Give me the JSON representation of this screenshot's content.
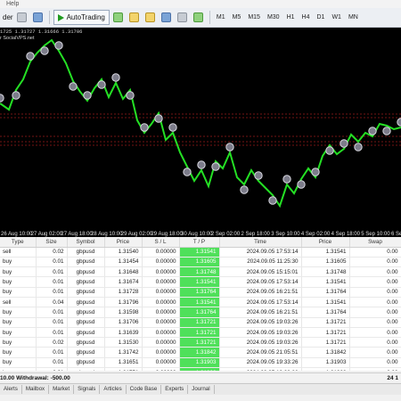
{
  "menubar": {
    "items": [
      "Help"
    ]
  },
  "toolbar": {
    "order_label": "der",
    "autotrading_label": "AutoTrading",
    "timeframes": [
      "M1",
      "M5",
      "M15",
      "M30",
      "H1",
      "H4",
      "D1",
      "W1",
      "MN"
    ]
  },
  "chart": {
    "info_line": "1725 1.31727 1.31666 1.31706",
    "sub_line": "r SocialVPS.net",
    "bg_color": "#000000",
    "line_color": "#24e024",
    "level_color": "#9c1a1a",
    "x_ticks": [
      "26 Aug 10:00",
      "27 Aug 02:00",
      "27 Aug 18:00",
      "28 Aug 10:00",
      "29 Aug 02:00",
      "29 Aug 18:00",
      "30 Aug 10:00",
      "2 Sep 02:00",
      "2 Sep 18:00",
      "3 Sep 10:00",
      "4 Sep 02:00",
      "4 Sep 18:00",
      "5 Sep 10:00",
      "6 Sep"
    ]
  },
  "table": {
    "headers": [
      "Type",
      "Size",
      "Symbol",
      "Price",
      "S / L",
      "T / P",
      "Time",
      "Price",
      "Swap"
    ],
    "rows": [
      [
        "sell",
        "0.02",
        "gbpusd",
        "1.31540",
        "0.00000",
        "1.31541",
        "2024.09.05 17:53:14",
        "1.31541",
        "0.00"
      ],
      [
        "buy",
        "0.01",
        "gbpusd",
        "1.31454",
        "0.00000",
        "1.31605",
        "2024.09.05 11:25:30",
        "1.31605",
        "0.00"
      ],
      [
        "buy",
        "0.01",
        "gbpusd",
        "1.31648",
        "0.00000",
        "1.31748",
        "2024.09.05 15:15:01",
        "1.31748",
        "0.00"
      ],
      [
        "buy",
        "0.01",
        "gbpusd",
        "1.31674",
        "0.00000",
        "1.31541",
        "2024.09.05 17:53:14",
        "1.31541",
        "0.00"
      ],
      [
        "buy",
        "0.01",
        "gbpusd",
        "1.31728",
        "0.00000",
        "1.31764",
        "2024.09.05 16:21:51",
        "1.31764",
        "0.00"
      ],
      [
        "sell",
        "0.04",
        "gbpusd",
        "1.31796",
        "0.00000",
        "1.31541",
        "2024.09.05 17:53:14",
        "1.31541",
        "0.00"
      ],
      [
        "buy",
        "0.01",
        "gbpusd",
        "1.31598",
        "0.00000",
        "1.31764",
        "2024.09.05 16:21:51",
        "1.31764",
        "0.00"
      ],
      [
        "buy",
        "0.01",
        "gbpusd",
        "1.31706",
        "0.00000",
        "1.31721",
        "2024.09.05 19:03:26",
        "1.31721",
        "0.00"
      ],
      [
        "buy",
        "0.01",
        "gbpusd",
        "1.31639",
        "0.00000",
        "1.31721",
        "2024.09.05 19:03:26",
        "1.31721",
        "0.00"
      ],
      [
        "buy",
        "0.02",
        "gbpusd",
        "1.31530",
        "0.00000",
        "1.31721",
        "2024.09.05 19:03:26",
        "1.31721",
        "0.00"
      ],
      [
        "buy",
        "0.01",
        "gbpusd",
        "1.31742",
        "0.00000",
        "1.31842",
        "2024.09.05 21:05:51",
        "1.31842",
        "0.00"
      ],
      [
        "buy",
        "0.01",
        "gbpusd",
        "1.31651",
        "0.00000",
        "1.31903",
        "2024.09.05 19:33:26",
        "1.31903",
        "0.00"
      ],
      [
        "buy",
        "0.01",
        "gbpusd",
        "1.31751",
        "0.00000",
        "1.31903",
        "2024.09.05 19:03:26",
        "1.31903",
        "0.00"
      ]
    ]
  },
  "balance": {
    "left": "10.00  Withdrawal: -500.00",
    "right": "24 1"
  },
  "tabs": [
    "Alerts",
    "Mailbox",
    "Market",
    "Signals",
    "Articles",
    "Code Base",
    "Experts",
    "Journal"
  ]
}
